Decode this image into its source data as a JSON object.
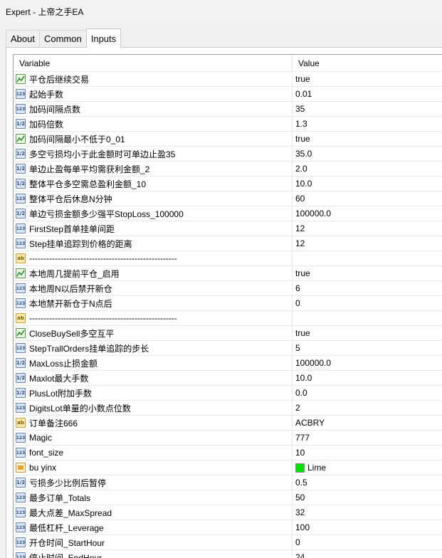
{
  "window": {
    "title": "Expert - 上帝之手EA"
  },
  "tabs": [
    {
      "label": "About",
      "active": false
    },
    {
      "label": "Common",
      "active": false
    },
    {
      "label": "Inputs",
      "active": true
    }
  ],
  "columns": {
    "variable": "Variable",
    "value": "Value"
  },
  "rows": [
    {
      "icon": "bool",
      "variable": "平仓后继续交易",
      "value": "true"
    },
    {
      "icon": "int",
      "variable": "起始手数",
      "value": "0.01"
    },
    {
      "icon": "int",
      "variable": "加码间隔点数",
      "value": "35"
    },
    {
      "icon": "dbl",
      "variable": "加码倍数",
      "value": "1.3"
    },
    {
      "icon": "bool",
      "variable": "加码间隔最小不低于0_01",
      "value": "true"
    },
    {
      "icon": "dbl",
      "variable": "多空亏损均小于此金额时可单边止盈35",
      "value": "35.0"
    },
    {
      "icon": "dbl",
      "variable": "单边止盈每单平均需获利金额_2",
      "value": "2.0"
    },
    {
      "icon": "dbl",
      "variable": "整体平仓多空需总盈利金额_10",
      "value": "10.0"
    },
    {
      "icon": "int",
      "variable": "整体平仓后休息N分钟",
      "value": "60"
    },
    {
      "icon": "dbl",
      "variable": "单边亏损金额多少强平StopLoss_100000",
      "value": "100000.0"
    },
    {
      "icon": "int",
      "variable": "FirstStep首单挂单间距",
      "value": "12"
    },
    {
      "icon": "int",
      "variable": "Step挂单追踪到价格的距离",
      "value": "12"
    },
    {
      "icon": "str",
      "variable": "----------------------------------------------------",
      "value": ""
    },
    {
      "icon": "bool",
      "variable": "本地周几提前平仓_启用",
      "value": "true"
    },
    {
      "icon": "int",
      "variable": "本地周N以后禁开新仓",
      "value": "6"
    },
    {
      "icon": "int",
      "variable": "本地禁开新仓于N点后",
      "value": "0"
    },
    {
      "icon": "str",
      "variable": "----------------------------------------------------",
      "value": ""
    },
    {
      "icon": "bool",
      "variable": "CloseBuySell多空互平",
      "value": "true"
    },
    {
      "icon": "int",
      "variable": "StepTrallOrders挂单追踪的步长",
      "value": "5"
    },
    {
      "icon": "dbl",
      "variable": "MaxLoss止损金额",
      "value": "100000.0"
    },
    {
      "icon": "dbl",
      "variable": "Maxlot最大手数",
      "value": "10.0"
    },
    {
      "icon": "dbl",
      "variable": "PlusLot附加手数",
      "value": "0.0"
    },
    {
      "icon": "int",
      "variable": "DigitsLot单量的小数点位数",
      "value": "2"
    },
    {
      "icon": "str",
      "variable": "订单备注666",
      "value": "ACBRY"
    },
    {
      "icon": "int",
      "variable": "Magic",
      "value": "777"
    },
    {
      "icon": "int",
      "variable": "font_size",
      "value": "10"
    },
    {
      "icon": "color",
      "variable": "bu yinx",
      "value": "Lime",
      "swatch": "#00e000"
    },
    {
      "icon": "dbl",
      "variable": "亏损多少比例后暂停",
      "value": "0.5"
    },
    {
      "icon": "int",
      "variable": "最多订单_Totals",
      "value": "50"
    },
    {
      "icon": "int",
      "variable": "最大点差_MaxSpread",
      "value": "32"
    },
    {
      "icon": "int",
      "variable": "最低杠杆_Leverage",
      "value": "100"
    },
    {
      "icon": "int",
      "variable": "开仓时间_StartHour",
      "value": "0"
    },
    {
      "icon": "int",
      "variable": "停止时间_EndHour",
      "value": "24"
    }
  ],
  "icon_text": {
    "int": "123",
    "dbl": "1/2",
    "str": "ab"
  }
}
